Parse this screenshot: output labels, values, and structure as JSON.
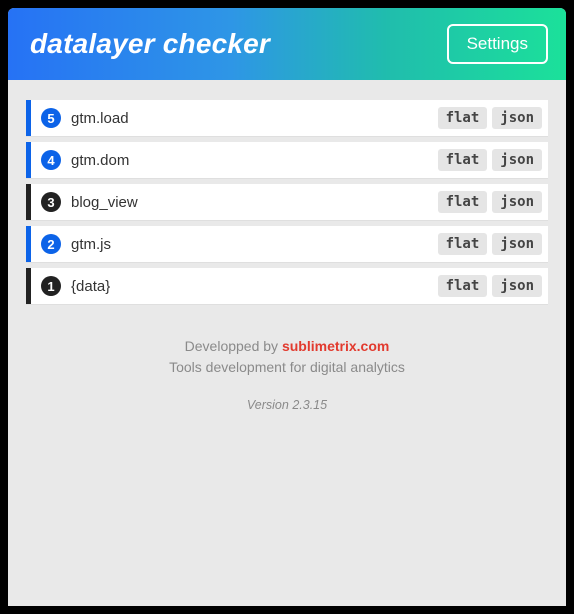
{
  "header": {
    "title": "datalayer checker",
    "settings_label": "Settings"
  },
  "rows": [
    {
      "index": "5",
      "event": "gtm.load",
      "kind": "gtm"
    },
    {
      "index": "4",
      "event": "gtm.dom",
      "kind": "gtm"
    },
    {
      "index": "3",
      "event": "blog_view",
      "kind": "data"
    },
    {
      "index": "2",
      "event": "gtm.js",
      "kind": "gtm"
    },
    {
      "index": "1",
      "event": "{data}",
      "kind": "data"
    }
  ],
  "buttons": {
    "flat": "flat",
    "json": "json"
  },
  "footer": {
    "dev_prefix": "Developped by ",
    "dev_link": "sublimetrix.com",
    "tagline": "Tools development for digital analytics",
    "version": "Version 2.3.15"
  }
}
